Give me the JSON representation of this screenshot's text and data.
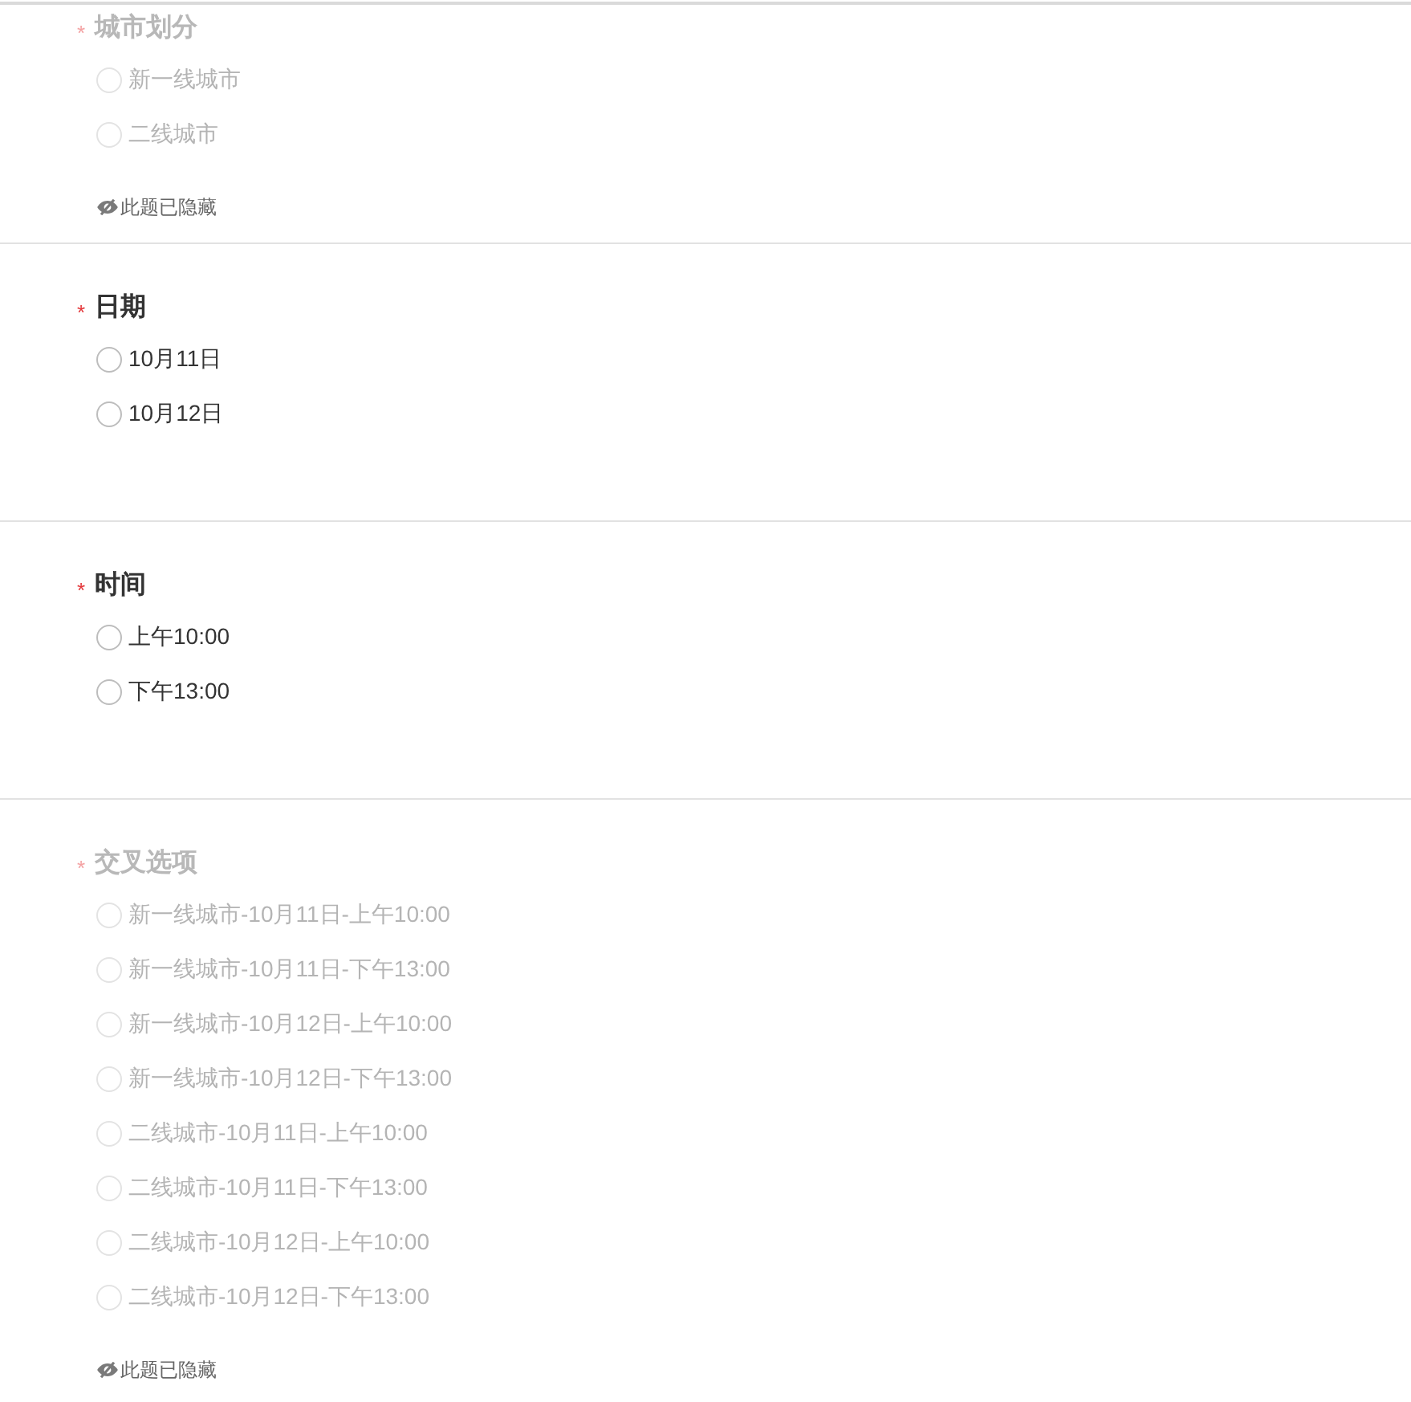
{
  "questions": [
    {
      "mark": "*",
      "title": "城市划分",
      "hidden": true,
      "hidden_note": "此题已隐藏",
      "options": [
        {
          "label": "新一线城市",
          "selected": false
        },
        {
          "label": "二线城市",
          "selected": false
        }
      ]
    },
    {
      "mark": "*",
      "title": "日期",
      "hidden": false,
      "options": [
        {
          "label": "10月11日",
          "selected": false
        },
        {
          "label": "10月12日",
          "selected": false
        }
      ]
    },
    {
      "mark": "*",
      "title": "时间",
      "hidden": false,
      "options": [
        {
          "label": "上午10:00",
          "selected": false
        },
        {
          "label": "下午13:00",
          "selected": false
        }
      ]
    },
    {
      "mark": "*",
      "title": "交叉选项",
      "hidden": true,
      "hidden_note": "此题已隐藏",
      "options": [
        {
          "label": "新一线城市-10月11日-上午10:00",
          "selected": false
        },
        {
          "label": "新一线城市-10月11日-下午13:00",
          "selected": false
        },
        {
          "label": "新一线城市-10月12日-上午10:00",
          "selected": false
        },
        {
          "label": "新一线城市-10月12日-下午13:00",
          "selected": false
        },
        {
          "label": "二线城市-10月11日-上午10:00",
          "selected": false
        },
        {
          "label": "二线城市-10月11日-下午13:00",
          "selected": false
        },
        {
          "label": "二线城市-10月12日-上午10:00",
          "selected": false
        },
        {
          "label": "二线城市-10月12日-下午13:00",
          "selected": false
        }
      ]
    }
  ]
}
